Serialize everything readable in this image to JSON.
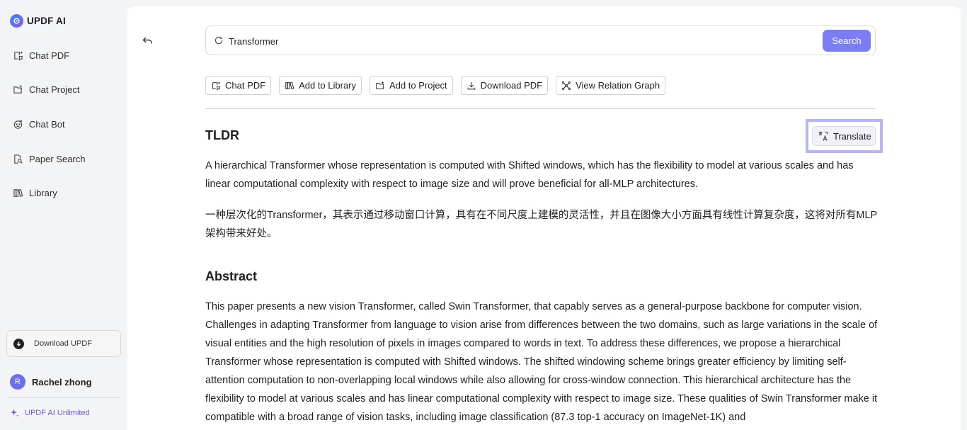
{
  "brand": {
    "name": "UPDF AI"
  },
  "sidebar": {
    "items": [
      {
        "label": "Chat PDF",
        "icon": "chat-pdf-icon"
      },
      {
        "label": "Chat Project",
        "icon": "chat-project-icon"
      },
      {
        "label": "Chat Bot",
        "icon": "chat-bot-icon"
      },
      {
        "label": "Paper Search",
        "icon": "paper-search-icon"
      },
      {
        "label": "Library",
        "icon": "library-icon"
      }
    ],
    "download_label": "Download UPDF",
    "user": {
      "initial": "R",
      "name": "Rachel zhong"
    },
    "plan_label": "UPDF AI Unlimited"
  },
  "search": {
    "value": "Transformer",
    "button_label": "Search"
  },
  "actions": [
    {
      "label": "Chat PDF",
      "icon": "chat-pdf-icon"
    },
    {
      "label": "Add to Library",
      "icon": "library-icon"
    },
    {
      "label": "Add to Project",
      "icon": "folder-icon"
    },
    {
      "label": "Download PDF",
      "icon": "download-icon"
    },
    {
      "label": "View Relation Graph",
      "icon": "graph-icon"
    }
  ],
  "tldr": {
    "heading": "TLDR",
    "translate_label": "Translate",
    "text": "A hierarchical Transformer whose representation is computed with Shifted windows, which has the flexibility to model at various scales and has linear computational complexity with respect to image size and will prove beneficial for all-MLP architectures.",
    "translation": "一种层次化的Transformer，其表示通过移动窗口计算，具有在不同尺度上建模的灵活性，并且在图像大小方面具有线性计算复杂度，这将对所有MLP架构带来好处。"
  },
  "abstract": {
    "heading": "Abstract",
    "text": "This paper presents a new vision Transformer, called Swin Transformer, that capably serves as a general-purpose backbone for computer vision. Challenges in adapting Transformer from language to vision arise from differences between the two domains, such as large variations in the scale of visual entities and the high resolution of pixels in images compared to words in text. To address these differences, we propose a hierarchical Transformer whose representation is computed with Shifted windows. The shifted windowing scheme brings greater efficiency by limiting self-attention computation to non-overlapping local windows while also allowing for cross-window connection. This hierarchical architecture has the flexibility to model at various scales and has linear computational complexity with respect to image size. These qualities of Swin Transformer make it compatible with a broad range of vision tasks, including image classification (87.3 top-1 accuracy on ImageNet-1K) and"
  },
  "colors": {
    "accent": "#7a7ef2",
    "highlight_border": "#b6b6f7",
    "plan": "#6b58e8"
  }
}
